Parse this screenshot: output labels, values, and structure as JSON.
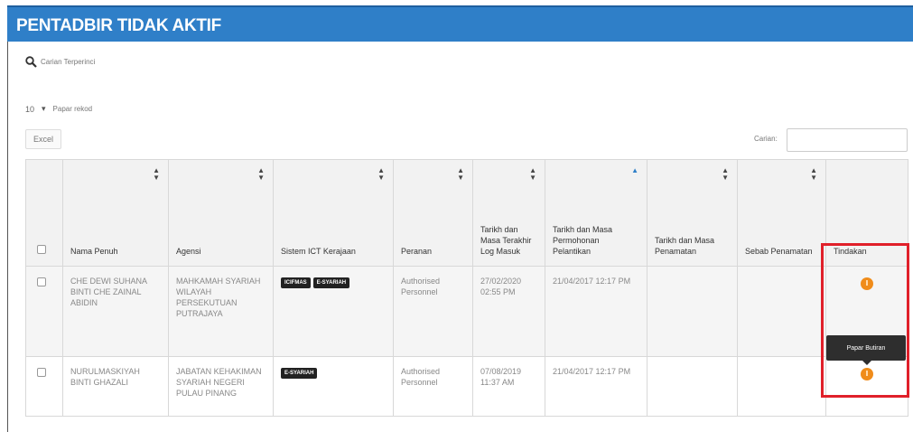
{
  "header": {
    "title": "PENTADBIR TIDAK AKTIF"
  },
  "advanced_search": {
    "label": "Carian Terperinci",
    "icon": "search-icon"
  },
  "page_length": {
    "value": "10",
    "label": "Papar rekod"
  },
  "toolbar": {
    "excel_label": "Excel"
  },
  "search": {
    "label": "Carian:",
    "placeholder": ""
  },
  "table": {
    "headers": {
      "nama": "Nama Penuh",
      "agensi": "Agensi",
      "sistem": "Sistem ICT Kerajaan",
      "peranan": "Peranan",
      "log": "Tarikh dan Masa Terakhir Log Masuk",
      "permohonan": "Tarikh dan Masa Permohonan Pelantikan",
      "penamatan": "Tarikh dan Masa Penamatan",
      "sebab": "Sebab Penamatan",
      "tindakan": "Tindakan"
    },
    "header_top": {
      "log": "Tarikh",
      "rest": "dan Masa Terakhir Log Masuk"
    },
    "rows": [
      {
        "nama": "CHE DEWI SUHANA BINTI CHE ZAINAL ABIDIN",
        "agensi": "MAHKAMAH SYARIAH WILAYAH PERSEKUTUAN PUTRAJAYA",
        "tags": [
          "ICIFMAS",
          "E-SYARIAH"
        ],
        "peranan": "Authorised Personnel",
        "log": "27/02/2020 02:55 PM",
        "permohonan": "21/04/2017 12:17 PM",
        "penamatan": "",
        "sebab": ""
      },
      {
        "nama": "NURULMASKIYAH BINTI GHAZALI",
        "agensi": "JABATAN KEHAKIMAN SYARIAH NEGERI PULAU PINANG",
        "tags": [
          "E-SYARIAH"
        ],
        "peranan": "Authorised Personnel",
        "log": "07/08/2019 11:37 AM",
        "permohonan": "21/04/2017 12:17 PM",
        "penamatan": "",
        "sebab": ""
      }
    ]
  },
  "tooltip": {
    "text": "Papar Butiran"
  },
  "colors": {
    "header": "#2f7fc8",
    "action": "#f08c1a",
    "highlight": "#e0202a"
  }
}
